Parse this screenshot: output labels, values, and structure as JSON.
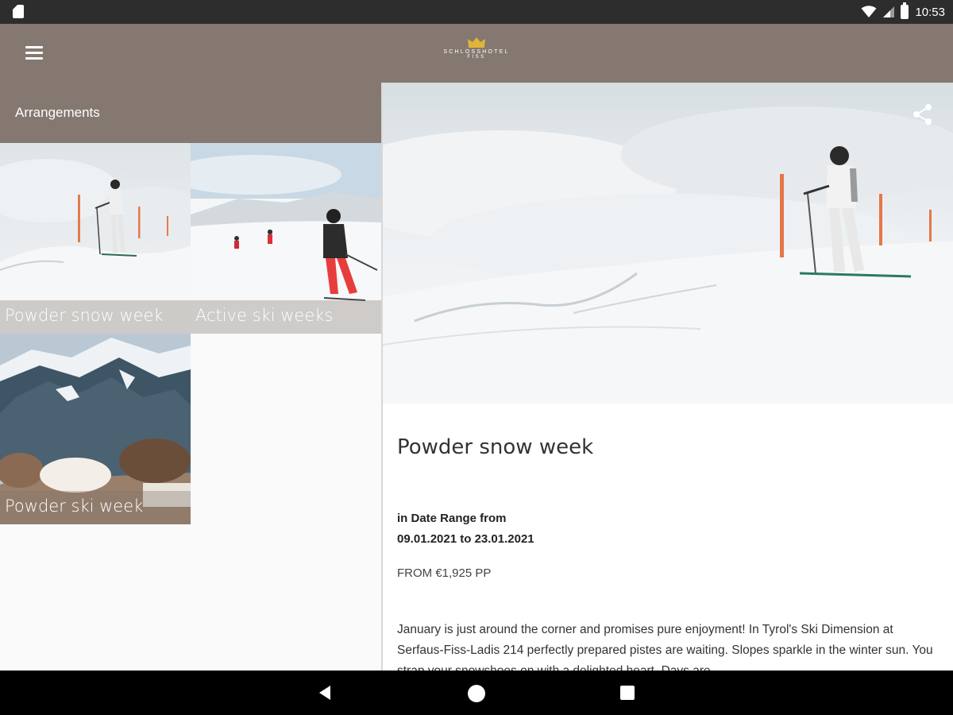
{
  "status_bar": {
    "time": "10:53",
    "icons": [
      "sim-card-icon",
      "wifi-icon",
      "cell-signal-icon",
      "battery-icon"
    ]
  },
  "app_bar": {
    "menu_icon": "hamburger-menu-icon",
    "logo_line1": "SCHLOSSHOTEL",
    "logo_line2": "FISS"
  },
  "left_pane": {
    "section_title": "Arrangements",
    "tiles": [
      {
        "label": "Powder snow week"
      },
      {
        "label": "Active ski weeks"
      },
      {
        "label": "Powder ski week"
      }
    ]
  },
  "detail": {
    "share_icon": "share-icon",
    "title": "Powder snow week",
    "date_label": "in Date Range from",
    "date_range": "09.01.2021 to 23.01.2021",
    "price": "FROM €1,925 PP",
    "description": "January is just around the corner and promises pure enjoyment! In Tyrol's Ski Dimension at Serfaus-Fiss-Ladis 214 perfectly prepared pistes are waiting. Slopes sparkle in the winter sun. You strap your snowshoes on with a delighted heart. Days are"
  },
  "nav_bar": {
    "icons": [
      "back-icon",
      "home-icon",
      "recents-icon"
    ]
  },
  "colors": {
    "brand": "#857870",
    "status_bar": "#2d2d2d",
    "nav_bar": "#000000"
  }
}
